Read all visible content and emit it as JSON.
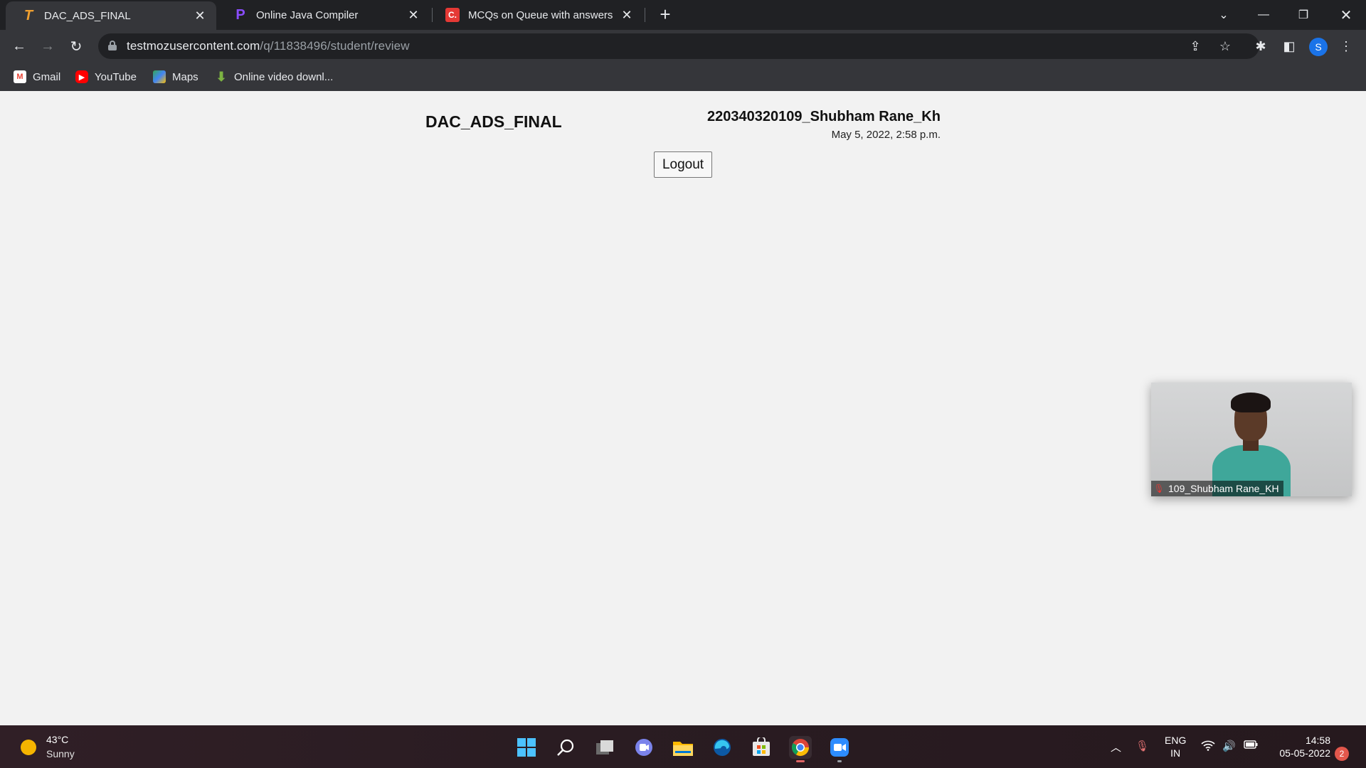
{
  "browser": {
    "tabs": [
      {
        "title": "DAC_ADS_FINAL",
        "favicon": "T",
        "favicon_color": "#f0a030",
        "active": true
      },
      {
        "title": "Online Java Compiler",
        "favicon": "P",
        "favicon_color": "#8a4dff",
        "active": false
      },
      {
        "title": "MCQs on Queue with answers",
        "favicon": "C.",
        "favicon_color": "#e53935",
        "active": false
      }
    ],
    "new_tab_label": "+",
    "url_domain": "testmozusercontent.com",
    "url_path": "/q/11838496/student/review",
    "profile_initial": "S",
    "bookmarks": [
      {
        "label": "Gmail",
        "icon": "gmail-icon",
        "color": "#ea4335"
      },
      {
        "label": "YouTube",
        "icon": "youtube-icon",
        "color": "#ff0000"
      },
      {
        "label": "Maps",
        "icon": "maps-icon",
        "color": "#34a853"
      },
      {
        "label": "Online video downl...",
        "icon": "download-icon",
        "color": "#7cb342"
      }
    ]
  },
  "page": {
    "test_title": "DAC_ADS_FINAL",
    "student_name": "220340320109_Shubham Rane_Kh",
    "date": "May 5, 2022, 2:58 p.m.",
    "logout_label": "Logout",
    "video_name": "109_Shubham Rane_KH"
  },
  "taskbar": {
    "temperature": "43°C",
    "condition": "Sunny",
    "lang_line1": "ENG",
    "lang_line2": "IN",
    "time": "14:58",
    "date": "05-05-2022",
    "notification_count": "2"
  }
}
